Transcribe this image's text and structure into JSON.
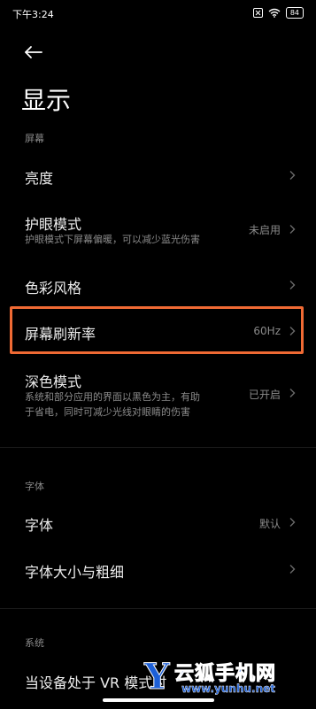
{
  "status_bar": {
    "time": "下午3:24",
    "battery": "84",
    "icons": [
      "alarm-off-icon",
      "wifi-icon",
      "battery-icon"
    ]
  },
  "header": {
    "back_icon": "back-arrow-icon",
    "title": "显示"
  },
  "sections": {
    "screen": {
      "label": "屏幕",
      "items": [
        {
          "title": "亮度",
          "value": ""
        },
        {
          "title": "护眼模式",
          "subtitle": "护眼模式下屏幕偏暖，可以减少蓝光伤害",
          "value": "未启用"
        },
        {
          "title": "色彩风格",
          "value": ""
        },
        {
          "title": "屏幕刷新率",
          "value": "60Hz"
        },
        {
          "title": "深色模式",
          "subtitle_line1": "系统和部分应用的界面以黑色为主，有助",
          "subtitle_line2": "于省电，同时可减少光线对眼睛的伤害",
          "value": "已开启"
        }
      ]
    },
    "font": {
      "label": "字体",
      "items": [
        {
          "title": "字体",
          "value": "默认"
        },
        {
          "title": "字体大小与粗细",
          "value": ""
        }
      ]
    },
    "system": {
      "label": "系统",
      "items": [
        {
          "title": "当设备处于 VR 模式时"
        }
      ]
    }
  },
  "watermark": {
    "letter": "Y",
    "name": "云狐手机网",
    "url": "www.yunhu.net"
  },
  "colors": {
    "background": "#000000",
    "highlight": "#f06a34",
    "watermark": "#1c5fd7"
  }
}
